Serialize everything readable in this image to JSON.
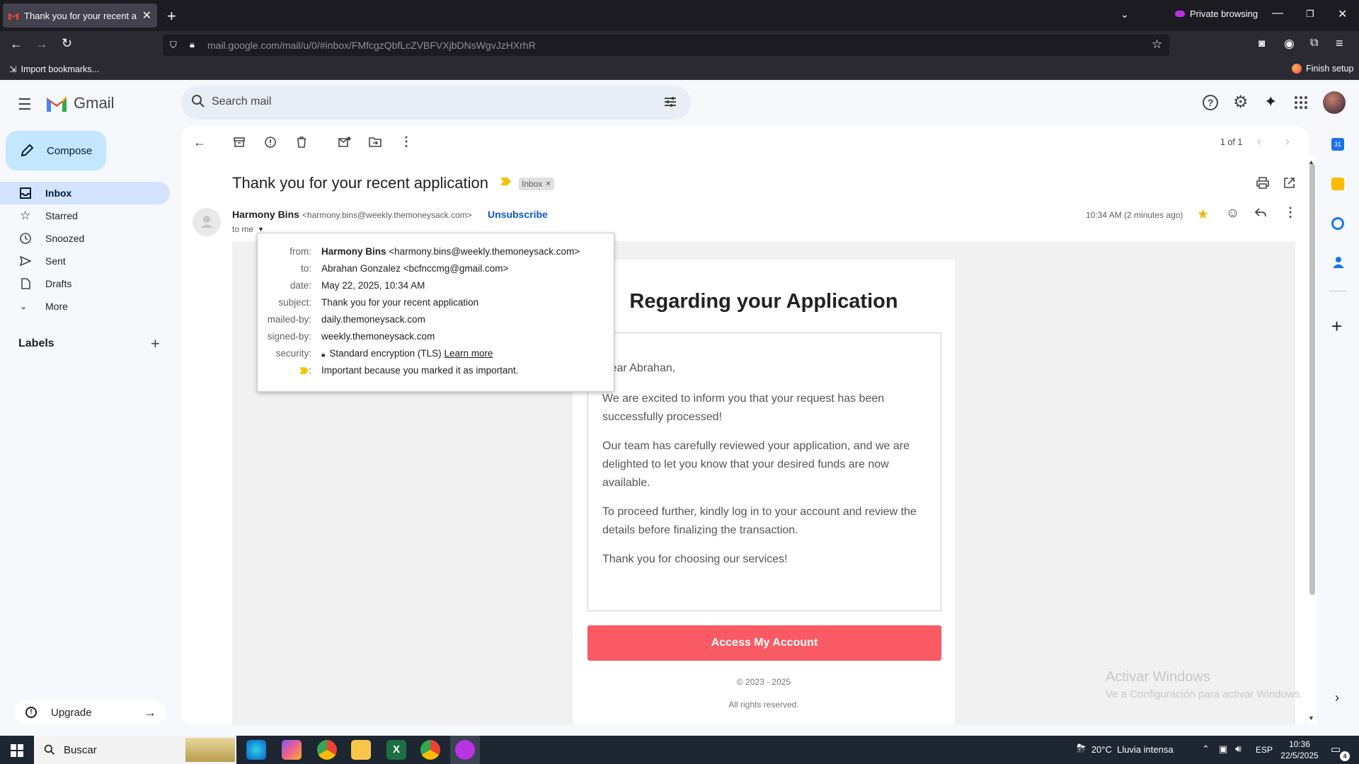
{
  "browser": {
    "tab_title": "Thank you for your recent appli",
    "url_host": "mail.google.com",
    "url_path": "/mail/u/0/#inbox/FMfcgzQbfLcZVBFVXjbDNsWgvJzHXrhR",
    "private_label": "Private browsing",
    "import_bookmarks": "Import bookmarks...",
    "finish_setup": "Finish setup"
  },
  "gmail": {
    "logo_text": "Gmail",
    "search_placeholder": "Search mail",
    "compose_label": "Compose",
    "nav": [
      {
        "label": "Inbox",
        "icon": "inbox-icon"
      },
      {
        "label": "Starred",
        "icon": "star-icon"
      },
      {
        "label": "Snoozed",
        "icon": "clock-icon"
      },
      {
        "label": "Sent",
        "icon": "send-icon"
      },
      {
        "label": "Drafts",
        "icon": "draft-icon"
      },
      {
        "label": "More",
        "icon": "chevron-down-icon"
      }
    ],
    "labels_title": "Labels",
    "upgrade_label": "Upgrade",
    "pagination": "1 of 1"
  },
  "message": {
    "subject": "Thank you for your recent application",
    "inbox_chip": "Inbox",
    "sender_name": "Harmony Bins",
    "sender_email": "<harmony.bins@weekly.themoneysack.com>",
    "unsubscribe": "Unsubscribe",
    "to_me": "to me",
    "time": "10:34 AM (2 minutes ago)"
  },
  "details_popup": {
    "rows": [
      {
        "label": "from:",
        "value_bold": "Harmony Bins",
        "value": " <harmony.bins@weekly.themoneysack.com>"
      },
      {
        "label": "to:",
        "value": "Abrahan Gonzalez <bcfnccmg@gmail.com>"
      },
      {
        "label": "date:",
        "value": "May 22, 2025, 10:34 AM"
      },
      {
        "label": "subject:",
        "value": "Thank you for your recent application"
      },
      {
        "label": "mailed-by:",
        "value": "daily.themoneysack.com"
      },
      {
        "label": "signed-by:",
        "value": "weekly.themoneysack.com"
      },
      {
        "label": "security:",
        "value": "Standard encryption (TLS)",
        "link": "Learn more"
      },
      {
        "label": ":",
        "value": "Important because you marked it as important."
      }
    ]
  },
  "email": {
    "heading": "Regarding your Application",
    "greeting": "Dear Abrahan,",
    "p1": "We are excited to inform you that your request has been successfully processed!",
    "p2": "Our team has carefully reviewed your application, and we are delighted to let you know that your desired funds are now available.",
    "p3": "To proceed further, kindly log in to your account and review the details before finalizing the transaction.",
    "p4": "Thank you for choosing our services!",
    "button": "Access My Account",
    "copyright": "© 2023 - 2025",
    "rights": "All rights reserved."
  },
  "watermark": {
    "line1": "Activar Windows",
    "line2": "Ve a Configuración para activar Windows."
  },
  "taskbar": {
    "search_label": "Buscar",
    "weather": "20°C  Lluvia intensa",
    "lang": "ESP",
    "time": "10:36",
    "date": "22/5/2025",
    "notif_count": "4"
  }
}
